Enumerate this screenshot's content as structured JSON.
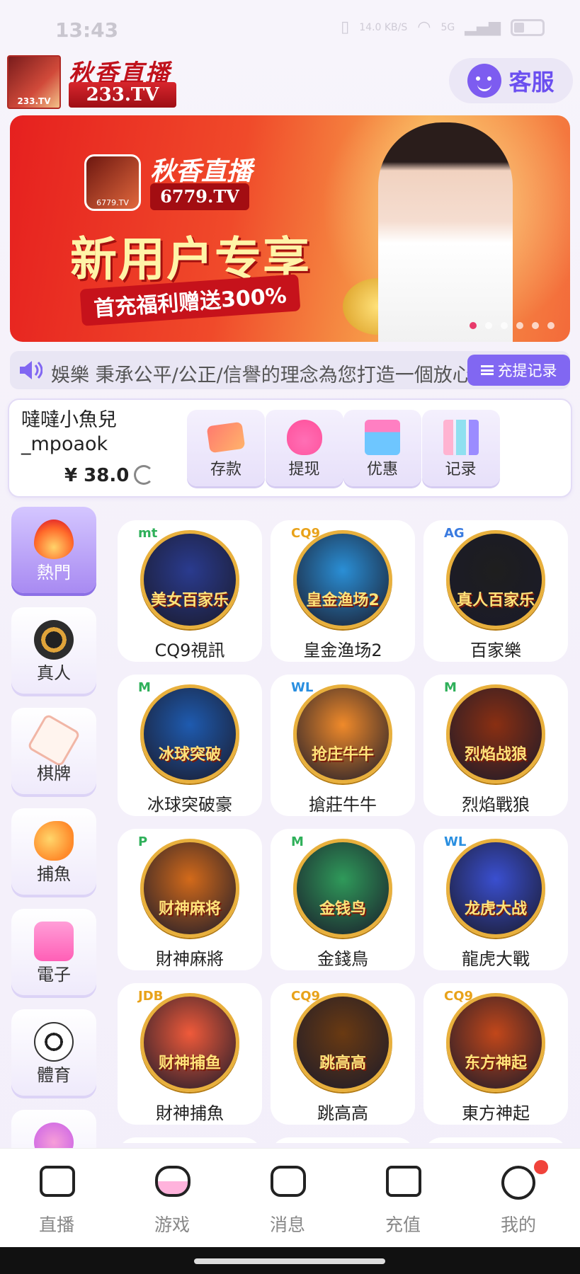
{
  "status_bar": {
    "time": "13:43",
    "net_speed": "14.0 KB/S",
    "signal": "5G"
  },
  "header": {
    "logo_badge": "233.TV",
    "logo_title": "秋香直播",
    "logo_sub": "233.TV",
    "customer_service": "客服"
  },
  "banner": {
    "brand": "秋香直播",
    "url": "6779.TV",
    "app_icon_label": "6779.TV",
    "headline": "新用户专享",
    "ribbon": "首充福利赠送300%",
    "slides_total": 6,
    "slide_active": 1
  },
  "marquee": {
    "text": "娛樂 秉承公平/公正/信譽的理念為您打造一個放心",
    "records_button": "充提记录"
  },
  "account": {
    "username": "噠噠小魚兒_mpoaok",
    "balance": "¥ 38.0",
    "actions": [
      {
        "label": "存款",
        "icon": "card-icon"
      },
      {
        "label": "提现",
        "icon": "money-bag-icon"
      },
      {
        "label": "优惠",
        "icon": "gift-icon"
      },
      {
        "label": "记录",
        "icon": "bar-chart-icon"
      }
    ]
  },
  "categories": [
    {
      "label": "熱門",
      "icon": "fire-icon",
      "active": true
    },
    {
      "label": "真人",
      "icon": "poker-chip-icon",
      "active": false
    },
    {
      "label": "棋牌",
      "icon": "playing-card-icon",
      "active": false
    },
    {
      "label": "捕魚",
      "icon": "fish-icon",
      "active": false
    },
    {
      "label": "電子",
      "icon": "slot-machine-icon",
      "active": false
    },
    {
      "label": "體育",
      "icon": "soccer-ball-icon",
      "active": false
    }
  ],
  "games": [
    {
      "name": "CQ9視訊",
      "provider": "mt",
      "art_text": "美女百家乐",
      "bg": "#2a3b8f"
    },
    {
      "name": "皇金渔场2",
      "provider": "CQ9",
      "art_text": "皇金渔场2",
      "bg": "#2a8fd6"
    },
    {
      "name": "百家樂",
      "provider": "AG",
      "art_text": "真人百家乐",
      "bg": "#1e1e1e"
    },
    {
      "name": "冰球突破豪",
      "provider": "M",
      "art_text": "冰球突破",
      "bg": "#1e5bb0"
    },
    {
      "name": "搶莊牛牛",
      "provider": "WL",
      "art_text": "抢庄牛牛",
      "bg": "#f08a2a"
    },
    {
      "name": "烈焰戰狼",
      "provider": "M",
      "art_text": "烈焰战狼",
      "bg": "#8a2f12"
    },
    {
      "name": "財神麻將",
      "provider": "P",
      "art_text": "财神麻将",
      "bg": "#d36a1a"
    },
    {
      "name": "金錢鳥",
      "provider": "M",
      "art_text": "金钱鸟",
      "bg": "#2f9a5a"
    },
    {
      "name": "龍虎大戰",
      "provider": "WL",
      "art_text": "龙虎大战",
      "bg": "#3a4fd0"
    },
    {
      "name": "財神捕魚",
      "provider": "JDB",
      "art_text": "财神捕鱼",
      "bg": "#f05a3a"
    },
    {
      "name": "跳高高",
      "provider": "CQ9",
      "art_text": "跳高高",
      "bg": "#6a3a12"
    },
    {
      "name": "東方神起",
      "provider": "CQ9",
      "art_text": "东方神起",
      "bg": "#c2471a"
    }
  ],
  "tabs": [
    {
      "label": "直播",
      "icon": "video-camera-icon"
    },
    {
      "label": "游戏",
      "icon": "gamepad-icon"
    },
    {
      "label": "消息",
      "icon": "message-icon"
    },
    {
      "label": "充值",
      "icon": "wallet-icon"
    },
    {
      "label": "我的",
      "icon": "smiley-icon"
    }
  ],
  "colors": {
    "accent": "#8167f2",
    "brand_red": "#c0121c",
    "notification": "#f0433b"
  }
}
